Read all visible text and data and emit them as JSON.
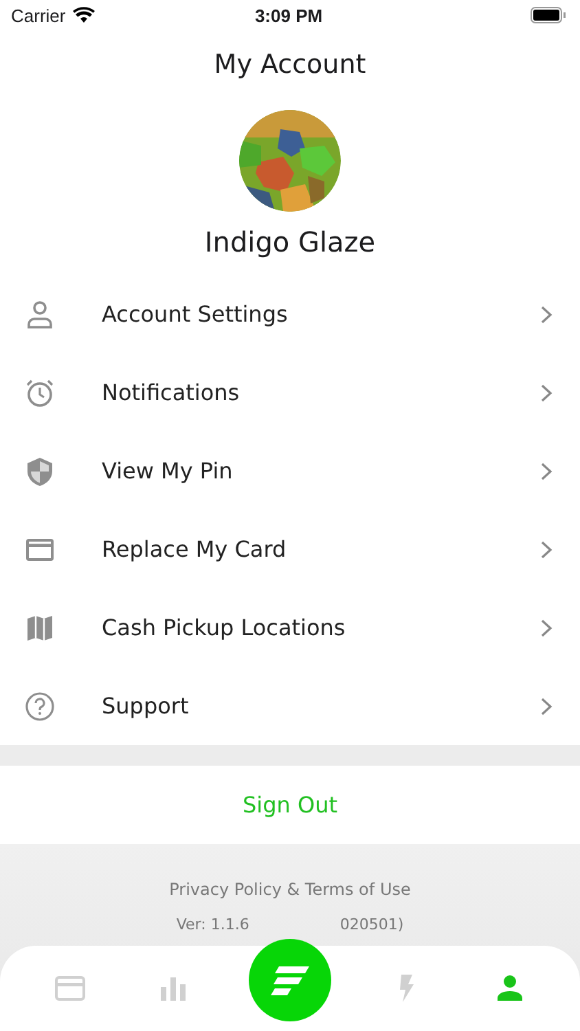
{
  "status_bar": {
    "carrier": "Carrier",
    "time": "3:09 PM"
  },
  "header": {
    "title": "My Account"
  },
  "profile": {
    "name": "Indigo Glaze"
  },
  "menu": [
    {
      "kind": "person",
      "label": "Account Settings"
    },
    {
      "kind": "alarm",
      "label": "Notifications"
    },
    {
      "kind": "shield",
      "label": "View My Pin"
    },
    {
      "kind": "card",
      "label": "Replace My Card"
    },
    {
      "kind": "map",
      "label": "Cash Pickup Locations"
    },
    {
      "kind": "help",
      "label": "Support"
    }
  ],
  "sign_out": "Sign Out",
  "footer": {
    "links": "Privacy Policy & Terms of Use",
    "version_start": "Ver: 1.1.6",
    "version_end": "020501)"
  },
  "tab_bar": [
    {
      "kind": "card",
      "selected": false
    },
    {
      "kind": "chart",
      "selected": false
    },
    {
      "kind": "logo"
    },
    {
      "kind": "bolt",
      "selected": false
    },
    {
      "kind": "person",
      "selected": true
    }
  ]
}
